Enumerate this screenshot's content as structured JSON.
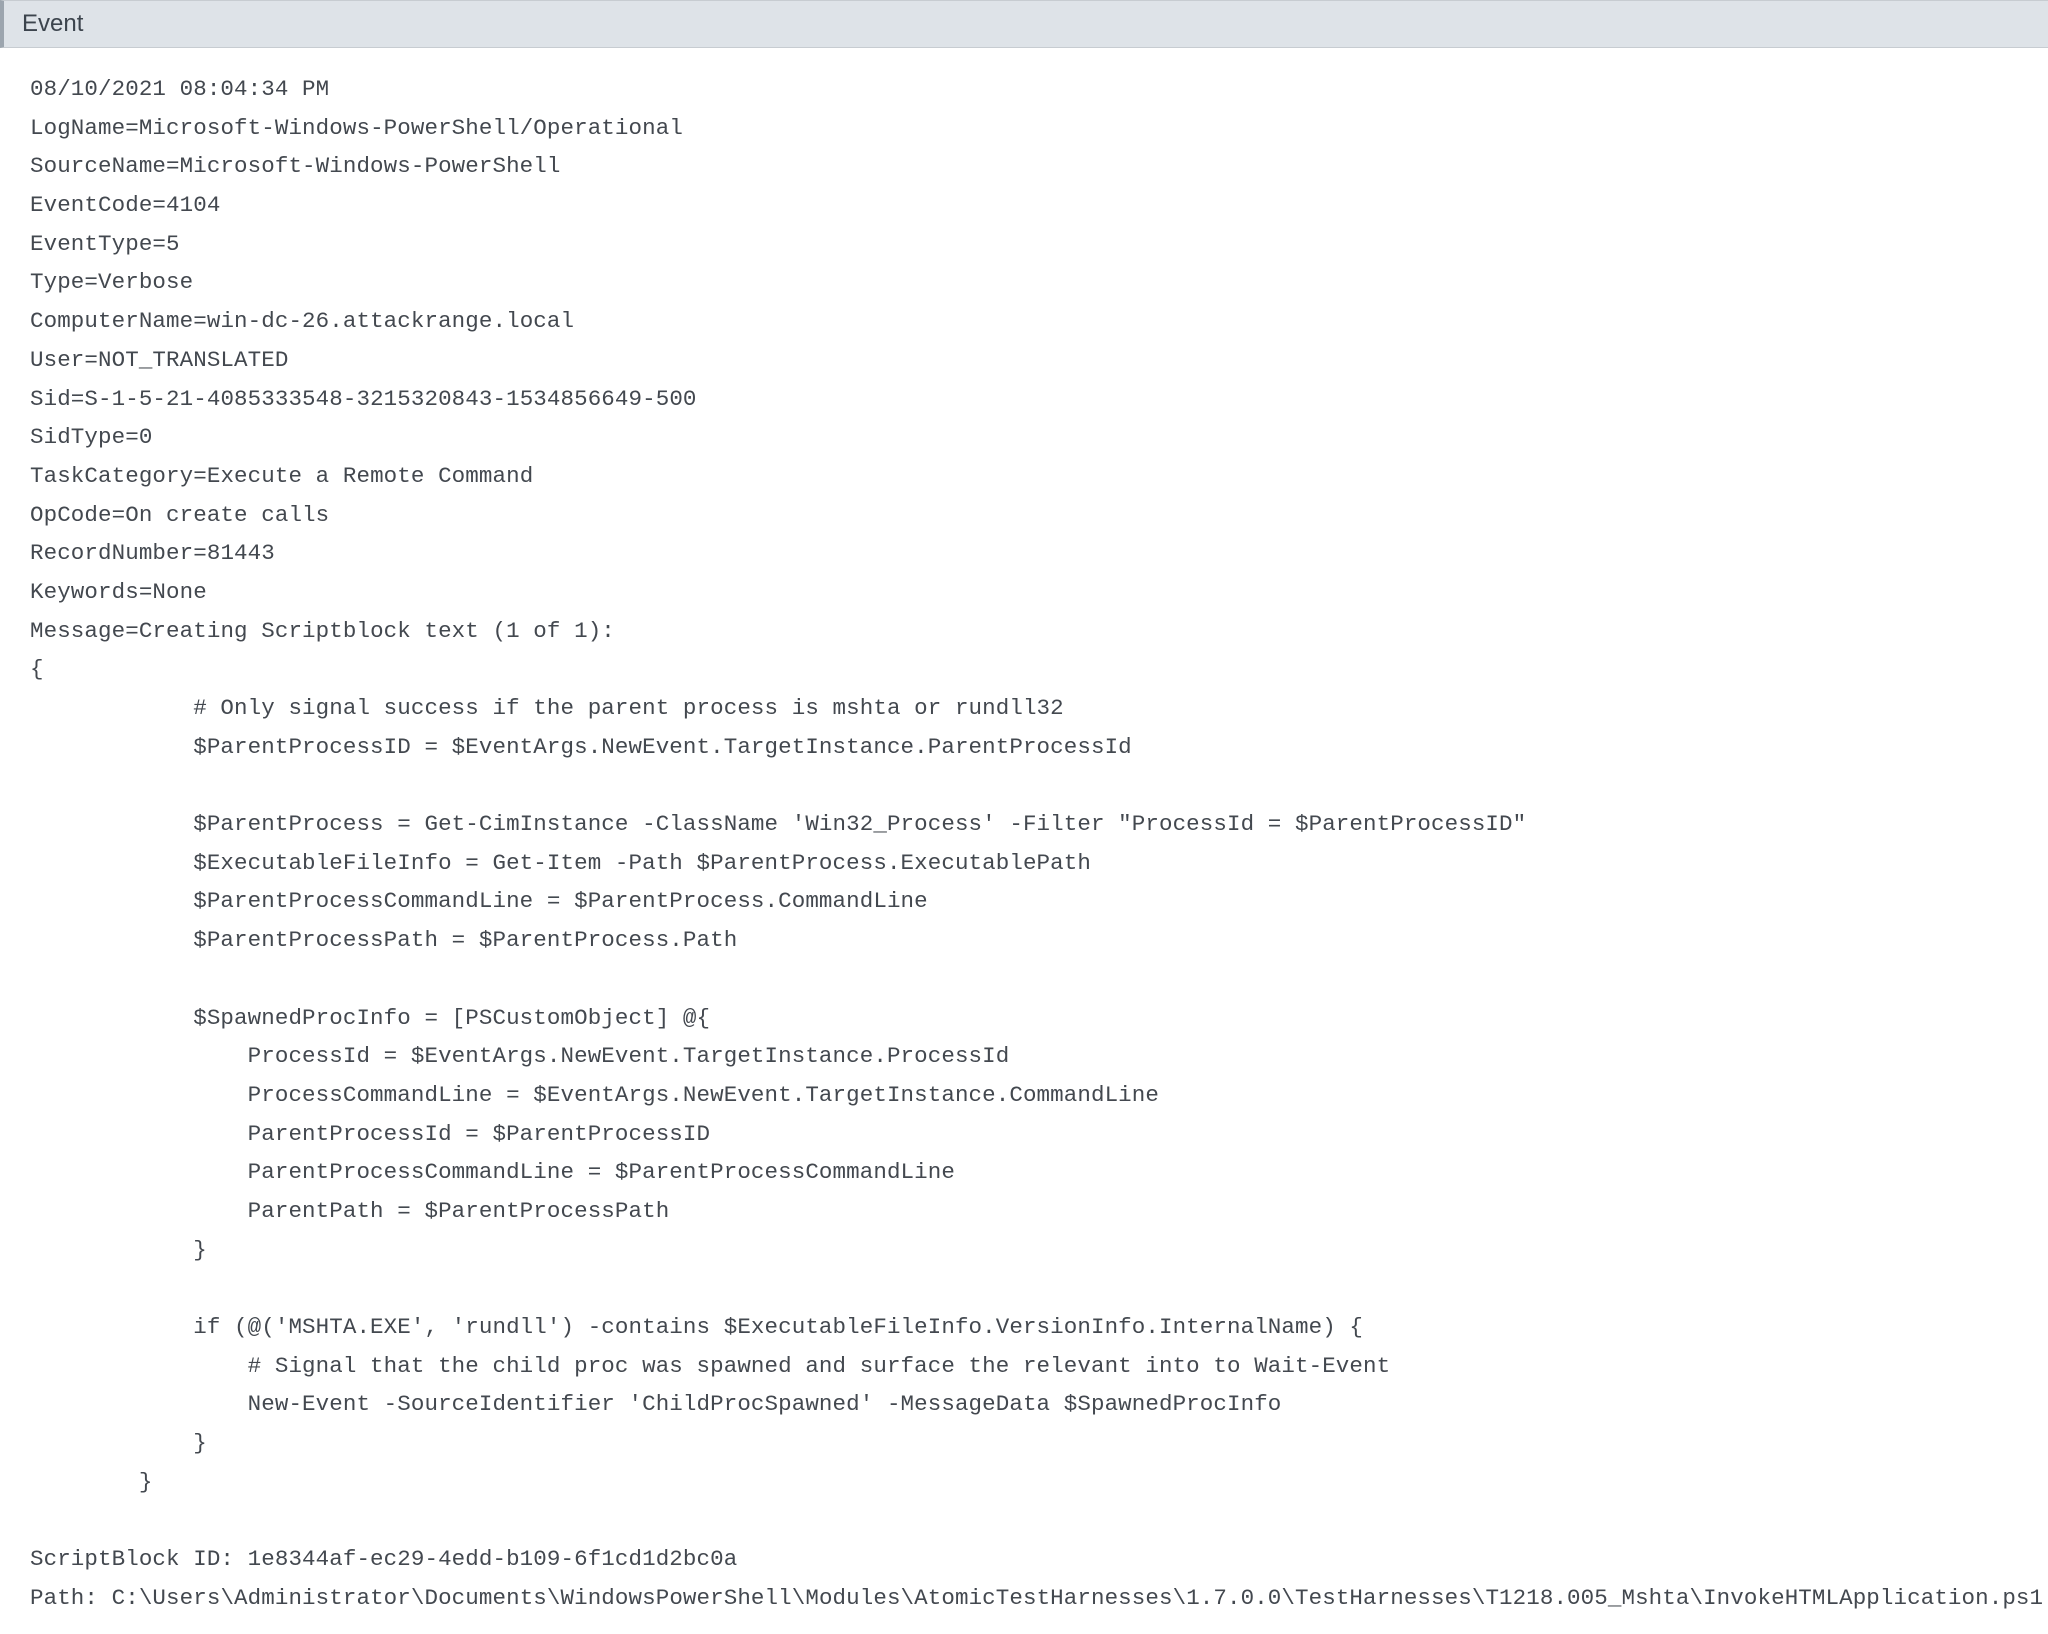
{
  "header": {
    "title": "Event"
  },
  "event": {
    "timestamp": "08/10/2021 08:04:34 PM",
    "LogName": "Microsoft-Windows-PowerShell/Operational",
    "SourceName": "Microsoft-Windows-PowerShell",
    "EventCode": "4104",
    "EventType": "5",
    "Type": "Verbose",
    "ComputerName": "win-dc-26.attackrange.local",
    "User": "NOT_TRANSLATED",
    "Sid": "S-1-5-21-4085333548-3215320843-1534856649-500",
    "SidType": "0",
    "TaskCategory": "Execute a Remote Command",
    "OpCode": "On create calls",
    "RecordNumber": "81443",
    "Keywords": "None",
    "MessageHeader": "Creating Scriptblock text (1 of 1):",
    "ScriptBlockId": "1e8344af-ec29-4edd-b109-6f1cd1d2bc0a",
    "Path": "C:\\Users\\Administrator\\Documents\\WindowsPowerShell\\Modules\\AtomicTestHarnesses\\1.7.0.0\\TestHarnesses\\T1218.005_Mshta\\InvokeHTMLApplication.ps1",
    "script_lines": [
      "{",
      "            # Only signal success if the parent process is mshta or rundll32",
      "            $ParentProcessID = $EventArgs.NewEvent.TargetInstance.ParentProcessId",
      "",
      "            $ParentProcess = Get-CimInstance -ClassName 'Win32_Process' -Filter \"ProcessId = $ParentProcessID\"",
      "            $ExecutableFileInfo = Get-Item -Path $ParentProcess.ExecutablePath",
      "            $ParentProcessCommandLine = $ParentProcess.CommandLine",
      "            $ParentProcessPath = $ParentProcess.Path",
      "",
      "            $SpawnedProcInfo = [PSCustomObject] @{",
      "                ProcessId = $EventArgs.NewEvent.TargetInstance.ProcessId",
      "                ProcessCommandLine = $EventArgs.NewEvent.TargetInstance.CommandLine",
      "                ParentProcessId = $ParentProcessID",
      "                ParentProcessCommandLine = $ParentProcessCommandLine",
      "                ParentPath = $ParentProcessPath",
      "            }",
      "",
      "            if (@('MSHTA.EXE', 'rundll') -contains $ExecutableFileInfo.VersionInfo.InternalName) {",
      "                # Signal that the child proc was spawned and surface the relevant into to Wait-Event",
      "                New-Event -SourceIdentifier 'ChildProcSpawned' -MessageData $SpawnedProcInfo",
      "            }",
      "        }"
    ]
  }
}
